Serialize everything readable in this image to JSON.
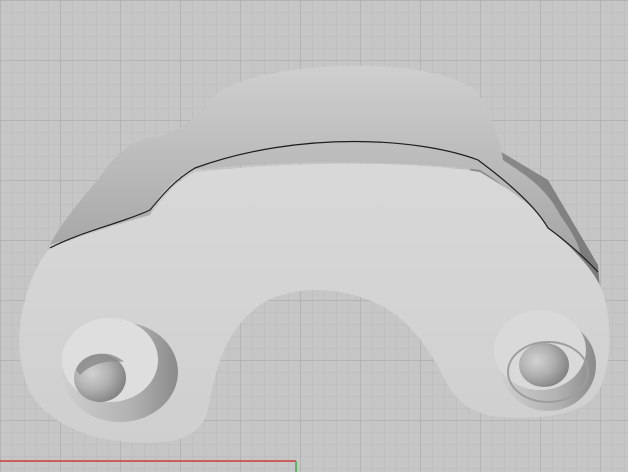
{
  "viewport": {
    "background_color": "#c6c6c6",
    "grid_minor_color": "#b8b8b8",
    "grid_major_color": "#a9a9a9",
    "axis_x_color": "#cc3b3b",
    "axis_y_color": "#3fae3f",
    "model_face_color": "#d3d3d3",
    "model_edge_color": "#1e1e1e"
  },
  "model": {
    "object": "clamp-bracket",
    "bosses": 2
  }
}
